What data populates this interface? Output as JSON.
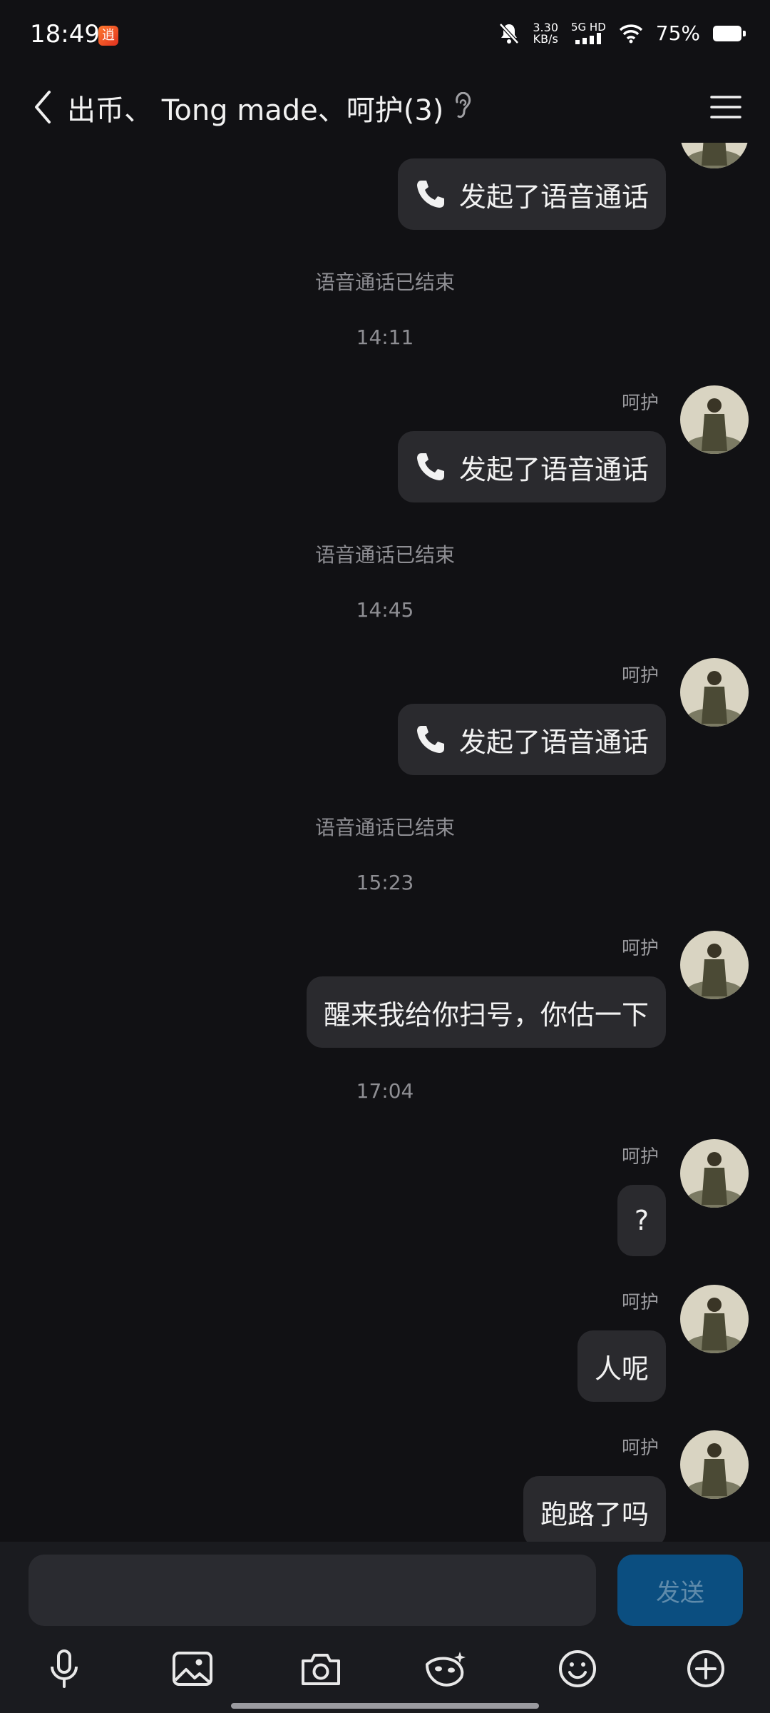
{
  "status_bar": {
    "time": "18:49",
    "app_badge": "逍",
    "speed_top": "3.30",
    "speed_bottom": "KB/s",
    "network_top": "5G HD",
    "battery": "75%"
  },
  "header": {
    "title": "出币、 Tong made、呵护(3)"
  },
  "messages": {
    "call_label": "发起了语音通话",
    "call_ended": "语音通话已结束",
    "sender": "呵护",
    "time_1": "14:11",
    "time_2": "14:45",
    "time_3": "15:23",
    "text_1": "醒来我给你扫号，你估一下",
    "time_4": "17:04",
    "text_2": "?",
    "text_3": "人呢",
    "text_4": "跑路了吗"
  },
  "input": {
    "placeholder": "",
    "send_label": "发送"
  },
  "icons": [
    "back-icon",
    "ear-icon",
    "menu-icon",
    "phone-icon",
    "microphone-icon",
    "image-icon",
    "camera-icon",
    "face-mask-icon",
    "emoji-icon",
    "plus-icon"
  ],
  "colors": {
    "background": "#111114",
    "bubble": "#2a2a2e",
    "send_button": "#0b4e80"
  }
}
